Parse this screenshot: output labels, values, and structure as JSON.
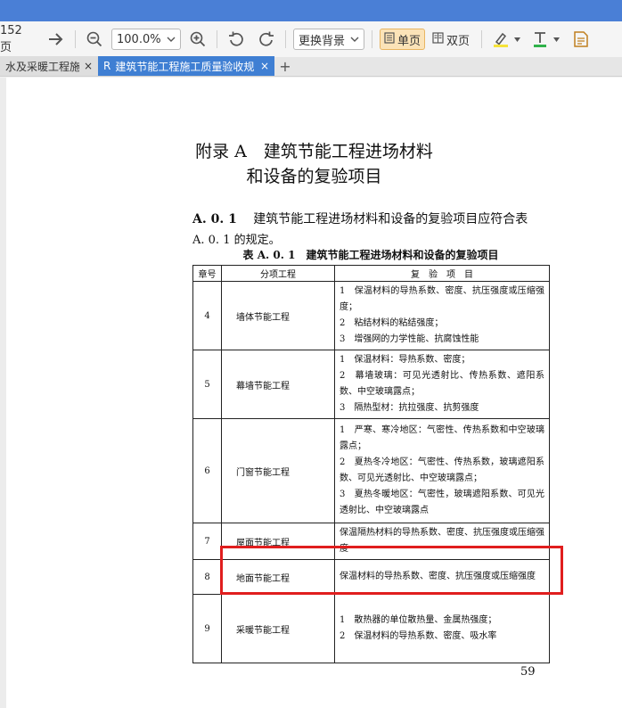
{
  "toolbar": {
    "page_count": "152页",
    "zoom": "100.0%",
    "background_label": "更换背景",
    "single_page_label": "单页",
    "double_page_label": "双页"
  },
  "tabs": [
    {
      "title": "水及采暖工程施工",
      "close": "×"
    },
    {
      "title": "建筑节能工程施工质量验收规",
      "icon": "R",
      "close": "×"
    }
  ],
  "tab_add": "+",
  "document": {
    "appendix_title": "附录 A　建筑节能工程进场材料",
    "appendix_title_2": "和设备的复验项目",
    "clause_no": "A. 0. 1",
    "clause_text": "建筑节能工程进场材料和设备的复验项目应符合表",
    "clause_text_2": "A. 0. 1 的规定。",
    "table_caption": "表 A. 0. 1　建筑节能工程进场材料和设备的复验项目",
    "table": {
      "headers": [
        "章号",
        "分项工程",
        "复　验　项　目"
      ],
      "rows": [
        {
          "no": "4",
          "item": "墙体节能工程",
          "lines": [
            "1　保温材料的导热系数、密度、抗压强度或压缩强度；",
            "2　粘结材料的粘结强度；",
            "3　增强网的力学性能、抗腐蚀性能"
          ]
        },
        {
          "no": "5",
          "item": "幕墙节能工程",
          "lines": [
            "1　保温材料：导热系数、密度；",
            "2　幕墙玻璃：可见光透射比、传热系数、遮阳系数、中空玻璃露点；",
            "3　隔热型材：抗拉强度、抗剪强度"
          ]
        },
        {
          "no": "6",
          "item": "门窗节能工程",
          "lines": [
            "1　严寒、寒冷地区：气密性、传热系数和中空玻璃露点；",
            "2　夏热冬冷地区：气密性、传热系数，玻璃遮阳系数、可见光透射比、中空玻璃露点；",
            "3　夏热冬暖地区：气密性，玻璃遮阳系数、可见光透射比、中空玻璃露点"
          ]
        },
        {
          "no": "7",
          "item": "屋面节能工程",
          "lines": [
            "保温隔热材料的导热系数、密度、抗压强度或压缩强度"
          ]
        },
        {
          "no": "8",
          "item": "地面节能工程",
          "lines": [
            "保温材料的导热系数、密度、抗压强度或压缩强度"
          ]
        },
        {
          "no": "9",
          "item": "采暖节能工程",
          "lines": [
            "1　散热器的单位散热量、金属热强度；",
            "2　保温材料的导热系数、密度、吸水率"
          ]
        }
      ]
    },
    "page_number": "59"
  },
  "colors": {
    "title_bar": "#4a7fd6",
    "active_tab": "#3f7fd3",
    "highlight_box": "#e01e1e",
    "active_view_button": "#fbe3b8"
  }
}
